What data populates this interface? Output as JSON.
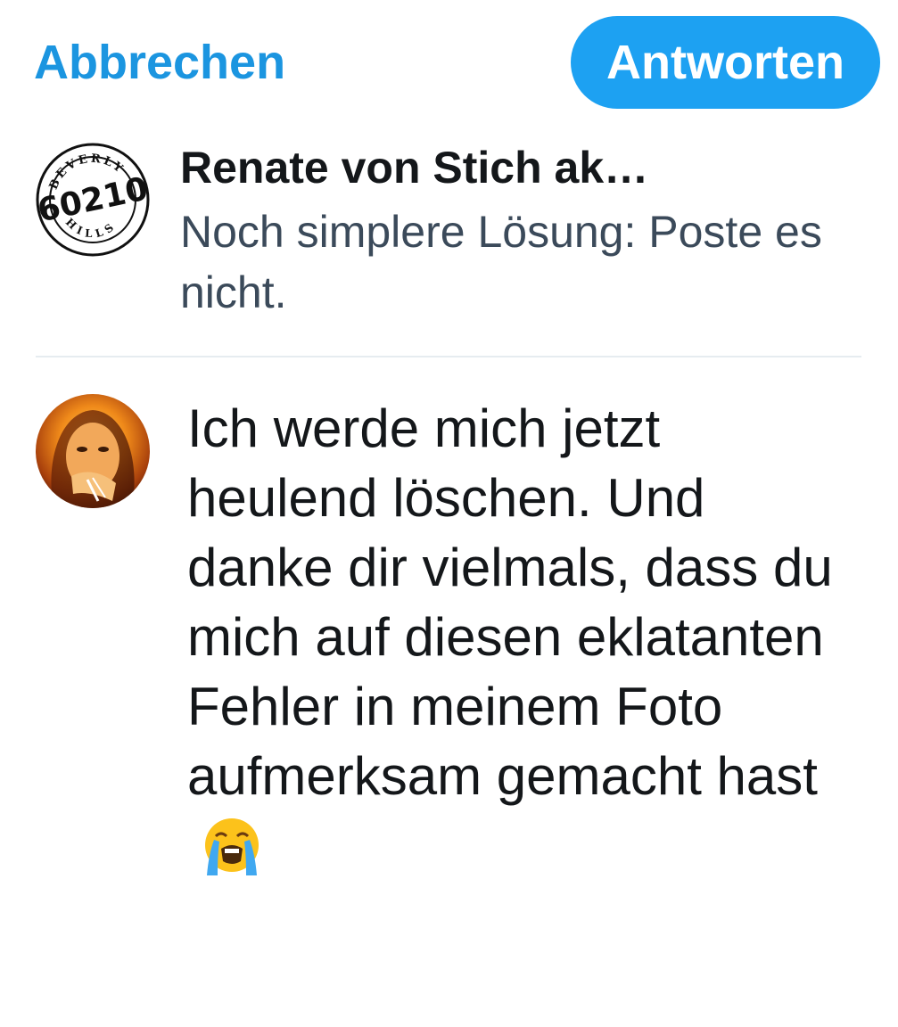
{
  "topbar": {
    "cancel_label": "Abbrechen",
    "reply_label": "Antworten"
  },
  "quoted_tweet": {
    "author": "Renate von Stich ak…",
    "text": "Noch simplere Lösung: Poste es nicht.",
    "avatar_text": {
      "top": "BEVERLY",
      "middle": "60210",
      "bottom": "HILLS"
    }
  },
  "reply": {
    "text": "Ich werde mich jetzt heulend löschen. Und danke dir vielmals, dass du mich auf diesen eklatanten Fehler in meinem Foto aufmerksam gemacht hast",
    "emoji": "loudly-crying-face-emoji"
  },
  "colors": {
    "accent": "#1da1f2",
    "link": "#1b95e0",
    "text": "#14171a",
    "secondary_text": "#3b4a5a",
    "divider": "#e6ecf0"
  }
}
